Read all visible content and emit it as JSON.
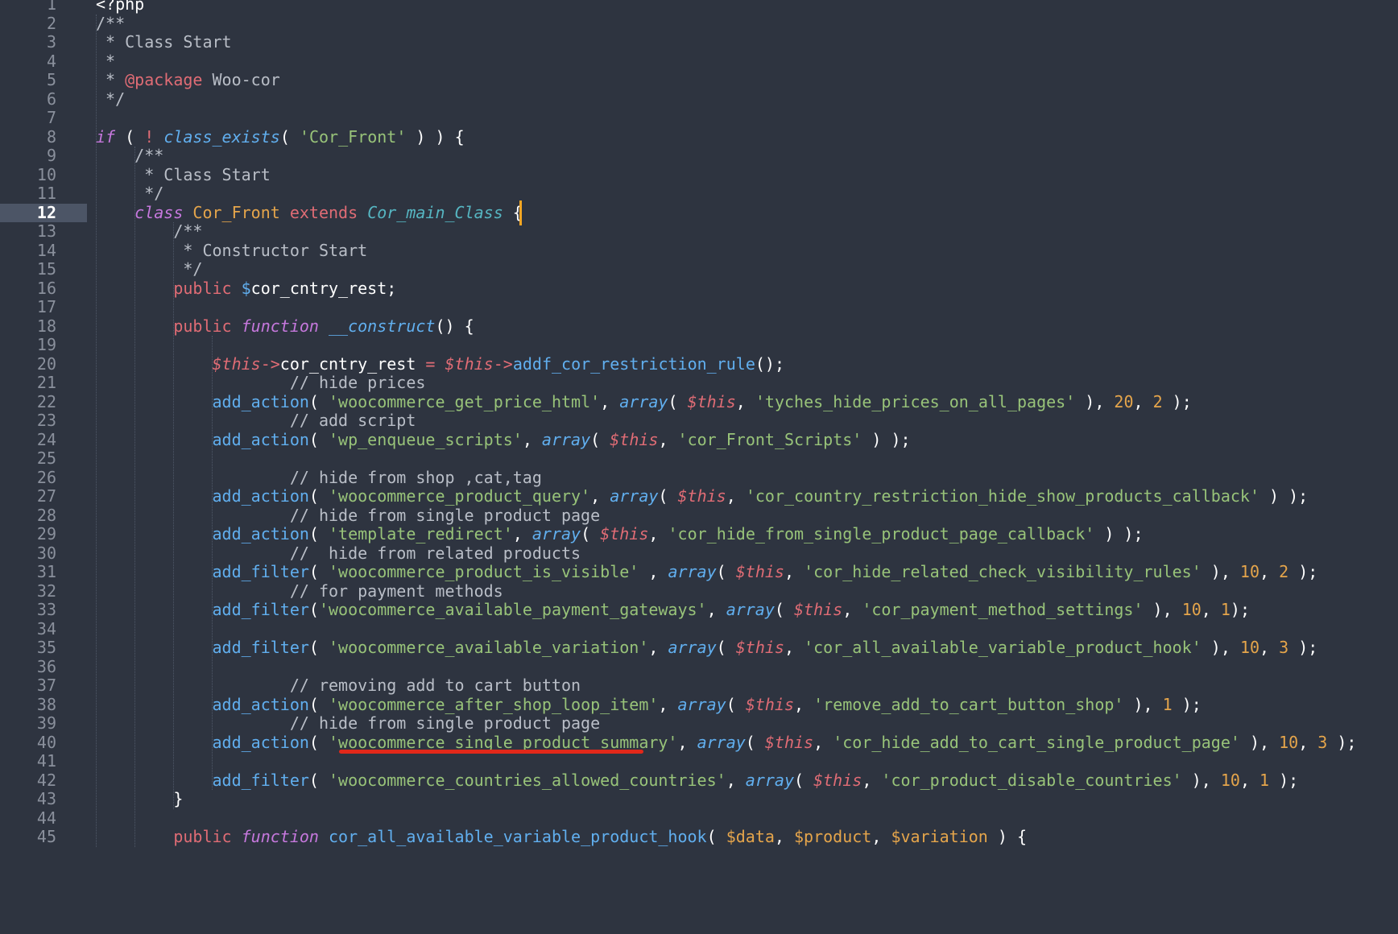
{
  "editor": {
    "active_line": 12,
    "line_numbers": [
      "1",
      "2",
      "3",
      "4",
      "5",
      "6",
      "7",
      "8",
      "9",
      "10",
      "11",
      "12",
      "13",
      "14",
      "15",
      "16",
      "17",
      "18",
      "19",
      "20",
      "21",
      "22",
      "23",
      "24",
      "25",
      "26",
      "27",
      "28",
      "29",
      "30",
      "31",
      "32",
      "33",
      "34",
      "35",
      "36",
      "37",
      "38",
      "39",
      "40",
      "41",
      "42",
      "43",
      "44",
      "45"
    ],
    "colors": {
      "background": "#2e3440",
      "active_gutter": "#4c5566",
      "cursor": "#f5a623",
      "underline": "#e2281a"
    },
    "lines": [
      [
        [
          "t-white",
          "<?php"
        ]
      ],
      [
        [
          "t-comment",
          "/**"
        ]
      ],
      [
        [
          "t-comment",
          " * Class Start"
        ]
      ],
      [
        [
          "t-comment",
          " *"
        ]
      ],
      [
        [
          "t-comment",
          " * "
        ],
        [
          "t-keyword",
          "@package"
        ],
        [
          "t-comment",
          " Woo-cor"
        ]
      ],
      [
        [
          "t-comment",
          " */"
        ]
      ],
      [],
      [
        [
          "t-italic-kw",
          "if"
        ],
        [
          "t-punc",
          " ( "
        ],
        [
          "t-op",
          "!"
        ],
        [
          "t-punc",
          " "
        ],
        [
          "t-func-i",
          "class_exists"
        ],
        [
          "t-punc",
          "( "
        ],
        [
          "t-string",
          "'Cor_Front'"
        ],
        [
          "t-punc",
          " ) ) {"
        ]
      ],
      [
        [
          "t-comment",
          "    /**"
        ]
      ],
      [
        [
          "t-comment",
          "     * Class Start"
        ]
      ],
      [
        [
          "t-comment",
          "     */"
        ]
      ],
      [
        [
          "t-italic-kw",
          "    class"
        ],
        [
          "t-punc",
          " "
        ],
        [
          "t-class",
          "Cor_Front"
        ],
        [
          "t-punc",
          " "
        ],
        [
          "t-keyword",
          "extends"
        ],
        [
          "t-punc",
          " "
        ],
        [
          "t-class-i",
          "Cor_main_Class"
        ],
        [
          "t-punc",
          " {"
        ]
      ],
      [
        [
          "t-comment",
          "        /**"
        ]
      ],
      [
        [
          "t-comment",
          "         * Constructor Start"
        ]
      ],
      [
        [
          "t-comment",
          "         */"
        ]
      ],
      [
        [
          "t-keyword",
          "        public"
        ],
        [
          "t-punc",
          " "
        ],
        [
          "t-dollar",
          "$"
        ],
        [
          "t-white",
          "cor_cntry_rest"
        ],
        [
          "t-punc",
          ";"
        ]
      ],
      [],
      [
        [
          "t-keyword",
          "        public"
        ],
        [
          "t-punc",
          " "
        ],
        [
          "t-italic-kw",
          "function"
        ],
        [
          "t-punc",
          " "
        ],
        [
          "t-func-i",
          "__construct"
        ],
        [
          "t-punc",
          "() {"
        ]
      ],
      [],
      [
        [
          "t-this",
          "            $this"
        ],
        [
          "t-op",
          "->"
        ],
        [
          "t-white",
          "cor_cntry_rest"
        ],
        [
          "t-punc",
          " "
        ],
        [
          "t-op",
          "="
        ],
        [
          "t-punc",
          " "
        ],
        [
          "t-this",
          "$this"
        ],
        [
          "t-op",
          "->"
        ],
        [
          "t-func",
          "addf_cor_restriction_rule"
        ],
        [
          "t-punc",
          "();"
        ]
      ],
      [
        [
          "t-comment",
          "                    // hide prices"
        ]
      ],
      [
        [
          "t-func",
          "            add_action"
        ],
        [
          "t-punc",
          "( "
        ],
        [
          "t-string",
          "'woocommerce_get_price_html'"
        ],
        [
          "t-punc",
          ", "
        ],
        [
          "t-func-i",
          "array"
        ],
        [
          "t-punc",
          "( "
        ],
        [
          "t-this",
          "$this"
        ],
        [
          "t-punc",
          ", "
        ],
        [
          "t-string",
          "'tyches_hide_prices_on_all_pages'"
        ],
        [
          "t-punc",
          " ), "
        ],
        [
          "t-number",
          "20"
        ],
        [
          "t-punc",
          ", "
        ],
        [
          "t-number",
          "2"
        ],
        [
          "t-punc",
          " );"
        ]
      ],
      [
        [
          "t-comment",
          "                    // add script"
        ]
      ],
      [
        [
          "t-func",
          "            add_action"
        ],
        [
          "t-punc",
          "( "
        ],
        [
          "t-string",
          "'wp_enqueue_scripts'"
        ],
        [
          "t-punc",
          ", "
        ],
        [
          "t-func-i",
          "array"
        ],
        [
          "t-punc",
          "( "
        ],
        [
          "t-this",
          "$this"
        ],
        [
          "t-punc",
          ", "
        ],
        [
          "t-string",
          "'cor_Front_Scripts'"
        ],
        [
          "t-punc",
          " ) );"
        ]
      ],
      [],
      [
        [
          "t-comment",
          "                    // hide from shop ,cat,tag"
        ]
      ],
      [
        [
          "t-func",
          "            add_action"
        ],
        [
          "t-punc",
          "( "
        ],
        [
          "t-string",
          "'woocommerce_product_query'"
        ],
        [
          "t-punc",
          ", "
        ],
        [
          "t-func-i",
          "array"
        ],
        [
          "t-punc",
          "( "
        ],
        [
          "t-this",
          "$this"
        ],
        [
          "t-punc",
          ", "
        ],
        [
          "t-string",
          "'cor_country_restriction_hide_show_products_callback'"
        ],
        [
          "t-punc",
          " ) );"
        ]
      ],
      [
        [
          "t-comment",
          "                    // hide from single product page"
        ]
      ],
      [
        [
          "t-func",
          "            add_action"
        ],
        [
          "t-punc",
          "( "
        ],
        [
          "t-string",
          "'template_redirect'"
        ],
        [
          "t-punc",
          ", "
        ],
        [
          "t-func-i",
          "array"
        ],
        [
          "t-punc",
          "( "
        ],
        [
          "t-this",
          "$this"
        ],
        [
          "t-punc",
          ", "
        ],
        [
          "t-string",
          "'cor_hide_from_single_product_page_callback'"
        ],
        [
          "t-punc",
          " ) );"
        ]
      ],
      [
        [
          "t-comment",
          "                    //  hide from related products"
        ]
      ],
      [
        [
          "t-func",
          "            add_filter"
        ],
        [
          "t-punc",
          "( "
        ],
        [
          "t-string",
          "'woocommerce_product_is_visible'"
        ],
        [
          "t-punc",
          " , "
        ],
        [
          "t-func-i",
          "array"
        ],
        [
          "t-punc",
          "( "
        ],
        [
          "t-this",
          "$this"
        ],
        [
          "t-punc",
          ", "
        ],
        [
          "t-string",
          "'cor_hide_related_check_visibility_rules'"
        ],
        [
          "t-punc",
          " ), "
        ],
        [
          "t-number",
          "10"
        ],
        [
          "t-punc",
          ", "
        ],
        [
          "t-number",
          "2"
        ],
        [
          "t-punc",
          " );"
        ]
      ],
      [
        [
          "t-comment",
          "                    // for payment methods"
        ]
      ],
      [
        [
          "t-func",
          "            add_filter"
        ],
        [
          "t-punc",
          "("
        ],
        [
          "t-string",
          "'woocommerce_available_payment_gateways'"
        ],
        [
          "t-punc",
          ", "
        ],
        [
          "t-func-i",
          "array"
        ],
        [
          "t-punc",
          "( "
        ],
        [
          "t-this",
          "$this"
        ],
        [
          "t-punc",
          ", "
        ],
        [
          "t-string",
          "'cor_payment_method_settings'"
        ],
        [
          "t-punc",
          " ), "
        ],
        [
          "t-number",
          "10"
        ],
        [
          "t-punc",
          ", "
        ],
        [
          "t-number",
          "1"
        ],
        [
          "t-punc",
          ");"
        ]
      ],
      [],
      [
        [
          "t-func",
          "            add_filter"
        ],
        [
          "t-punc",
          "( "
        ],
        [
          "t-string",
          "'woocommerce_available_variation'"
        ],
        [
          "t-punc",
          ", "
        ],
        [
          "t-func-i",
          "array"
        ],
        [
          "t-punc",
          "( "
        ],
        [
          "t-this",
          "$this"
        ],
        [
          "t-punc",
          ", "
        ],
        [
          "t-string",
          "'cor_all_available_variable_product_hook'"
        ],
        [
          "t-punc",
          " ), "
        ],
        [
          "t-number",
          "10"
        ],
        [
          "t-punc",
          ", "
        ],
        [
          "t-number",
          "3"
        ],
        [
          "t-punc",
          " );"
        ]
      ],
      [],
      [
        [
          "t-comment",
          "                    // removing add to cart button"
        ]
      ],
      [
        [
          "t-func",
          "            add_action"
        ],
        [
          "t-punc",
          "( "
        ],
        [
          "t-string",
          "'woocommerce_after_shop_loop_item'"
        ],
        [
          "t-punc",
          ", "
        ],
        [
          "t-func-i",
          "array"
        ],
        [
          "t-punc",
          "( "
        ],
        [
          "t-this",
          "$this"
        ],
        [
          "t-punc",
          ", "
        ],
        [
          "t-string",
          "'remove_add_to_cart_button_shop'"
        ],
        [
          "t-punc",
          " ), "
        ],
        [
          "t-number",
          "1"
        ],
        [
          "t-punc",
          " );"
        ]
      ],
      [
        [
          "t-comment",
          "                    // hide from single product page"
        ]
      ],
      [
        [
          "t-func",
          "            add_action"
        ],
        [
          "t-punc",
          "( "
        ],
        [
          "t-string",
          "'woocommerce_single_product_summary'"
        ],
        [
          "t-punc",
          ", "
        ],
        [
          "t-func-i",
          "array"
        ],
        [
          "t-punc",
          "( "
        ],
        [
          "t-this",
          "$this"
        ],
        [
          "t-punc",
          ", "
        ],
        [
          "t-string",
          "'cor_hide_add_to_cart_single_product_page'"
        ],
        [
          "t-punc",
          " ), "
        ],
        [
          "t-number",
          "10"
        ],
        [
          "t-punc",
          ", "
        ],
        [
          "t-number",
          "3"
        ],
        [
          "t-punc",
          " );"
        ]
      ],
      [],
      [
        [
          "t-func",
          "            add_filter"
        ],
        [
          "t-punc",
          "( "
        ],
        [
          "t-string",
          "'woocommerce_countries_allowed_countries'"
        ],
        [
          "t-punc",
          ", "
        ],
        [
          "t-func-i",
          "array"
        ],
        [
          "t-punc",
          "( "
        ],
        [
          "t-this",
          "$this"
        ],
        [
          "t-punc",
          ", "
        ],
        [
          "t-string",
          "'cor_product_disable_countries'"
        ],
        [
          "t-punc",
          " ), "
        ],
        [
          "t-number",
          "10"
        ],
        [
          "t-punc",
          ", "
        ],
        [
          "t-number",
          "1"
        ],
        [
          "t-punc",
          " );"
        ]
      ],
      [
        [
          "t-punc",
          "        }"
        ]
      ],
      [],
      [
        [
          "t-keyword",
          "        public"
        ],
        [
          "t-punc",
          " "
        ],
        [
          "t-italic-kw",
          "function"
        ],
        [
          "t-punc",
          " "
        ],
        [
          "t-func",
          "cor_all_available_variable_product_hook"
        ],
        [
          "t-punc",
          "( "
        ],
        [
          "t-var",
          "$data"
        ],
        [
          "t-punc",
          ", "
        ],
        [
          "t-var",
          "$product"
        ],
        [
          "t-punc",
          ", "
        ],
        [
          "t-var",
          "$variation"
        ],
        [
          "t-punc",
          " ) {"
        ]
      ]
    ]
  }
}
